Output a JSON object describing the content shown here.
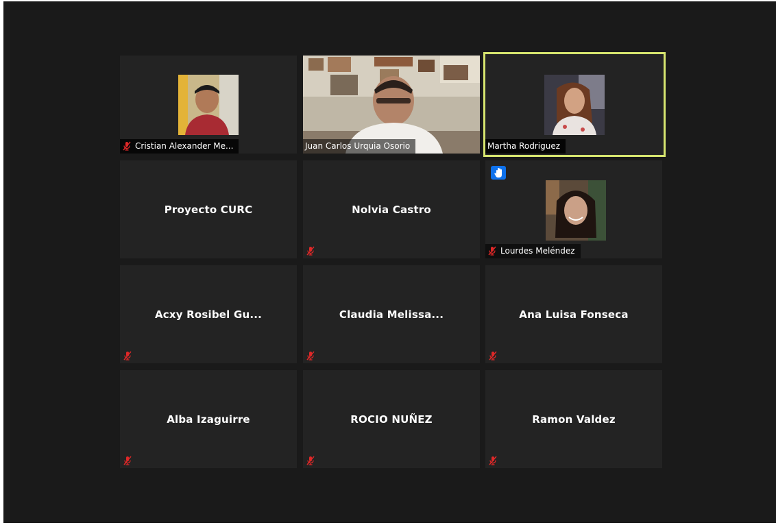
{
  "participants": [
    {
      "name": "Cristian Alexander Me...",
      "muted": true,
      "type": "avatar"
    },
    {
      "name": "Juan Carlos Urquia Osorio",
      "muted": false,
      "type": "video"
    },
    {
      "name": "Martha Rodriguez",
      "muted": false,
      "type": "avatar",
      "active_speaker": true
    },
    {
      "name": "Proyecto CURC",
      "muted": false,
      "type": "name-only"
    },
    {
      "name": "Nolvia Castro",
      "muted": true,
      "type": "name-only"
    },
    {
      "name": "Lourdes Meléndez",
      "muted": true,
      "type": "avatar",
      "hand_raised": true
    },
    {
      "name": "Acxy  Rosibel Gu...",
      "muted": true,
      "type": "name-only"
    },
    {
      "name": "Claudia  Melissa...",
      "muted": true,
      "type": "name-only"
    },
    {
      "name": "Ana Luisa Fonseca",
      "muted": true,
      "type": "name-only"
    },
    {
      "name": "Alba Izaguirre",
      "muted": true,
      "type": "name-only"
    },
    {
      "name": "ROCIO NUÑEZ",
      "muted": true,
      "type": "name-only"
    },
    {
      "name": "Ramon Valdez",
      "muted": true,
      "type": "name-only"
    }
  ],
  "colors": {
    "background": "#1a1a1a",
    "tile": "#232323",
    "active_speaker_border": "#d6e56f",
    "mute_icon": "#e02828",
    "raise_hand": "#0e71eb"
  },
  "icons": {
    "mute": "microphone-muted-icon",
    "hand": "raise-hand-icon"
  }
}
